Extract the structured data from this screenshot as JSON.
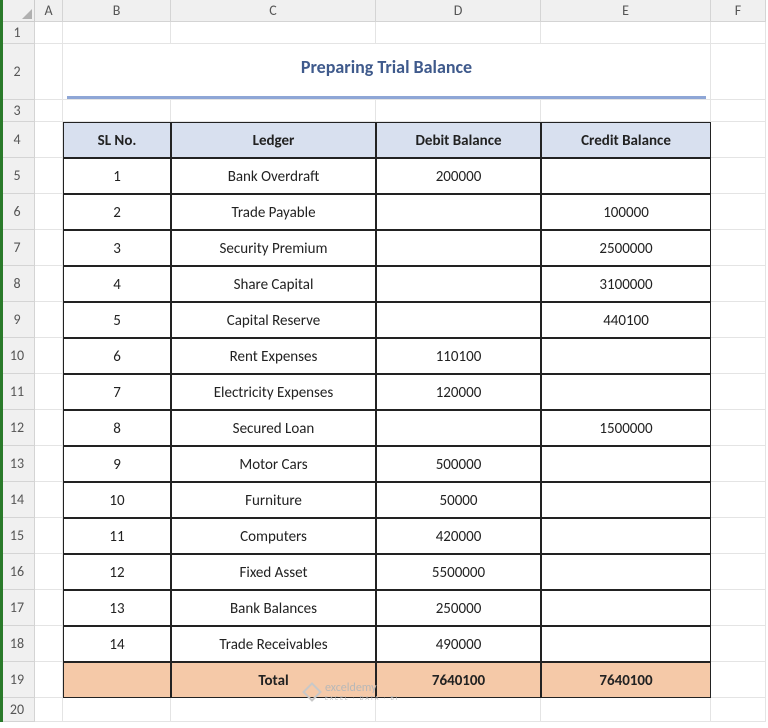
{
  "columns": [
    "A",
    "B",
    "C",
    "D",
    "E",
    "F"
  ],
  "rowsVisible": 20,
  "title": "Preparing Trial Balance",
  "headers": {
    "sl": "SL No.",
    "ledger": "Ledger",
    "debit": "Debit Balance",
    "credit": "Credit Balance"
  },
  "rows": [
    {
      "sl": "1",
      "ledger": "Bank Overdraft",
      "debit": "200000",
      "credit": ""
    },
    {
      "sl": "2",
      "ledger": "Trade Payable",
      "debit": "",
      "credit": "100000"
    },
    {
      "sl": "3",
      "ledger": "Security Premium",
      "debit": "",
      "credit": "2500000"
    },
    {
      "sl": "4",
      "ledger": "Share Capital",
      "debit": "",
      "credit": "3100000"
    },
    {
      "sl": "5",
      "ledger": "Capital Reserve",
      "debit": "",
      "credit": "440100"
    },
    {
      "sl": "6",
      "ledger": "Rent Expenses",
      "debit": "110100",
      "credit": ""
    },
    {
      "sl": "7",
      "ledger": "Electricity Expenses",
      "debit": "120000",
      "credit": ""
    },
    {
      "sl": "8",
      "ledger": "Secured Loan",
      "debit": "",
      "credit": "1500000"
    },
    {
      "sl": "9",
      "ledger": "Motor Cars",
      "debit": "500000",
      "credit": ""
    },
    {
      "sl": "10",
      "ledger": "Furniture",
      "debit": "50000",
      "credit": ""
    },
    {
      "sl": "11",
      "ledger": "Computers",
      "debit": "420000",
      "credit": ""
    },
    {
      "sl": "12",
      "ledger": "Fixed Asset",
      "debit": "5500000",
      "credit": ""
    },
    {
      "sl": "13",
      "ledger": "Bank Balances",
      "debit": "250000",
      "credit": ""
    },
    {
      "sl": "14",
      "ledger": "Trade Receivables",
      "debit": "490000",
      "credit": ""
    }
  ],
  "total": {
    "label": "Total",
    "debit": "7640100",
    "credit": "7640100"
  },
  "watermark": {
    "brand": "exceldemy",
    "sub": "EXCEL · DATA · BI"
  },
  "chart_data": {
    "type": "table",
    "title": "Preparing Trial Balance",
    "columns": [
      "SL No.",
      "Ledger",
      "Debit Balance",
      "Credit Balance"
    ],
    "data": [
      [
        1,
        "Bank Overdraft",
        200000,
        null
      ],
      [
        2,
        "Trade Payable",
        null,
        100000
      ],
      [
        3,
        "Security Premium",
        null,
        2500000
      ],
      [
        4,
        "Share Capital",
        null,
        3100000
      ],
      [
        5,
        "Capital Reserve",
        null,
        440100
      ],
      [
        6,
        "Rent Expenses",
        110100,
        null
      ],
      [
        7,
        "Electricity Expenses",
        120000,
        null
      ],
      [
        8,
        "Secured Loan",
        null,
        1500000
      ],
      [
        9,
        "Motor Cars",
        500000,
        null
      ],
      [
        10,
        "Furniture",
        50000,
        null
      ],
      [
        11,
        "Computers",
        420000,
        null
      ],
      [
        12,
        "Fixed Asset",
        5500000,
        null
      ],
      [
        13,
        "Bank Balances",
        250000,
        null
      ],
      [
        14,
        "Trade Receivables",
        490000,
        null
      ]
    ],
    "totals": {
      "Debit Balance": 7640100,
      "Credit Balance": 7640100
    }
  }
}
